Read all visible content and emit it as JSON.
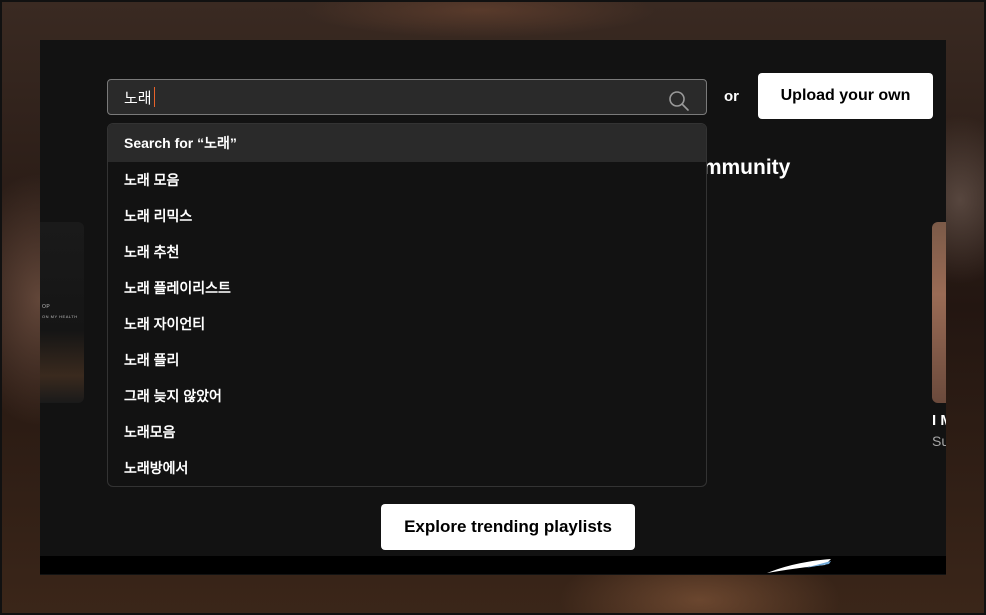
{
  "search": {
    "value": "노래",
    "suggestion_prefix": "Search for “",
    "suggestion_query": "노래 ",
    "suggestion_suffix": "”"
  },
  "or_label": "or",
  "upload_button": "Upload your own",
  "suggestions": [
    "노래 모음",
    "노래 리믹스",
    "노래 추천",
    "노래 플레이리스트",
    "노래 자이언티",
    "노래 플리",
    "그래 늦지 않았어",
    "노래모음",
    "노래방에서"
  ],
  "heading_peek": "ommunity",
  "left_card": {
    "line1": "OP",
    "line2": "ON MY HEALTH"
  },
  "right_card": {
    "title": "I M",
    "subtitle": "Su"
  },
  "explore_button": "Explore trending playlists",
  "colors": {
    "panel": "#121212",
    "field": "#2a2a2a",
    "caret": "#e8632a",
    "button": "#ffffff"
  },
  "icons": {
    "search": "search-icon"
  }
}
